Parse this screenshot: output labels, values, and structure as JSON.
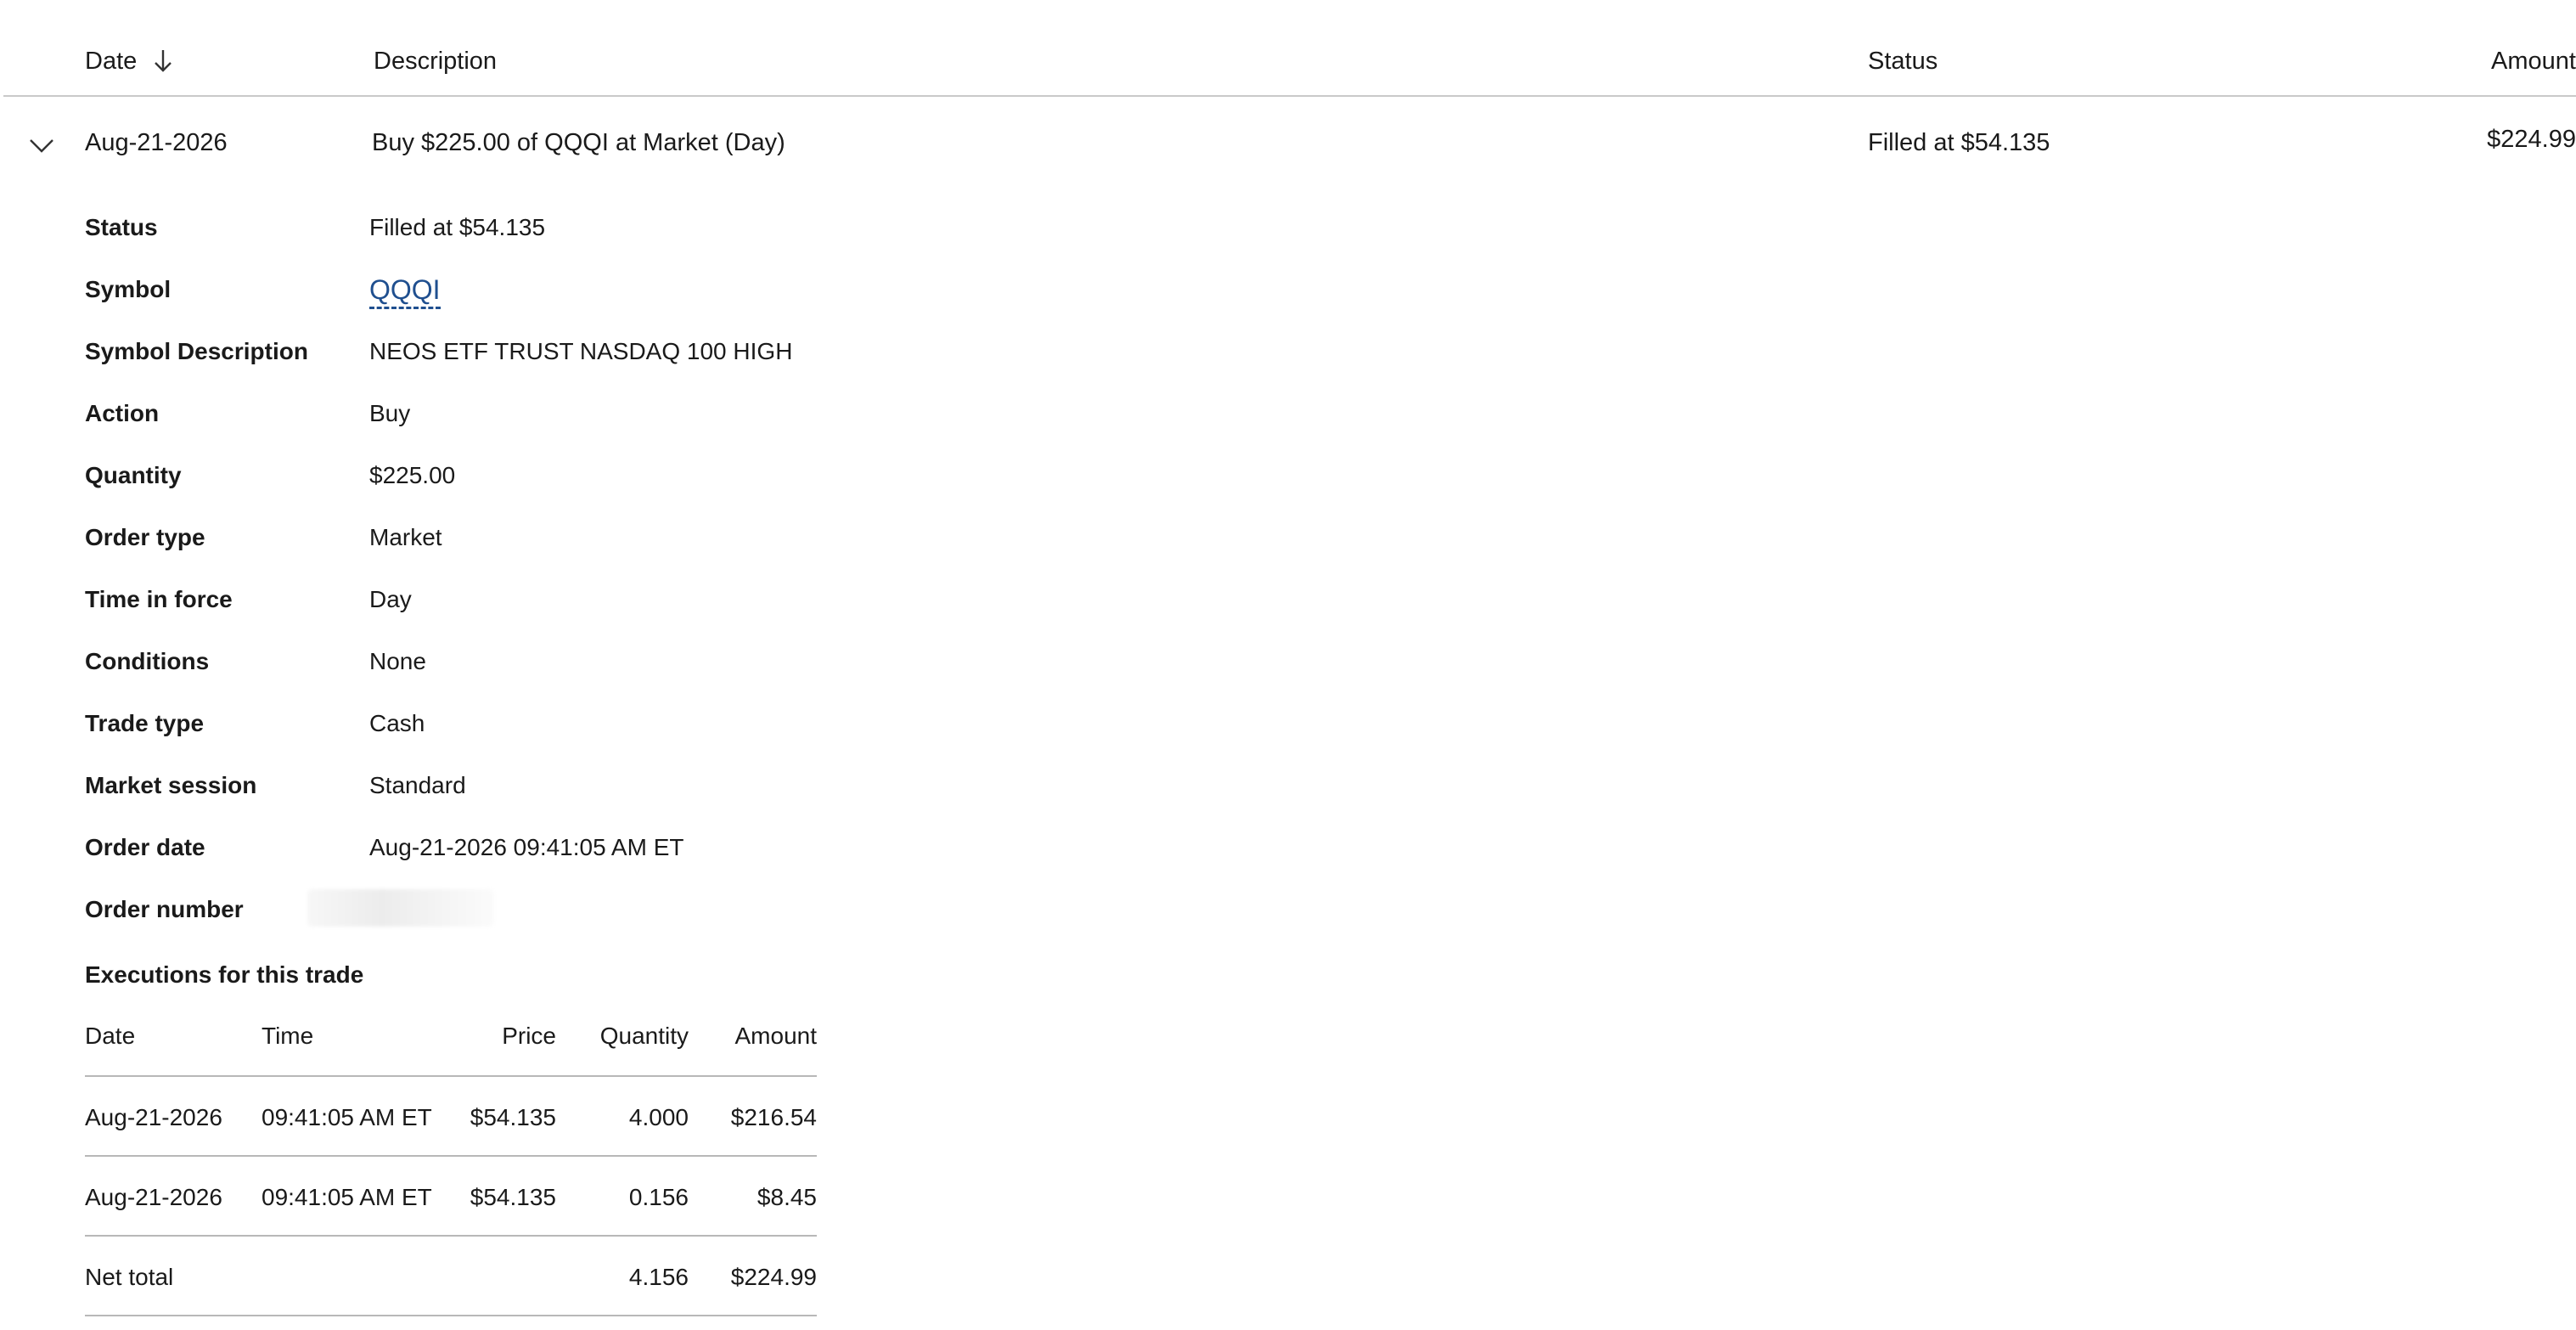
{
  "header": {
    "date_label": "Date",
    "sort_icon": "arrow-down-icon",
    "description_label": "Description",
    "status_label": "Status",
    "amount_label": "Amount"
  },
  "order": {
    "expand_icon": "chevron-down-icon",
    "date": "Aug-21-2026",
    "description": "Buy $225.00 of QQQI at Market (Day)",
    "status": "Filled at $54.135",
    "amount": "$224.99"
  },
  "details": {
    "status": {
      "label": "Status",
      "value": "Filled at $54.135"
    },
    "symbol": {
      "label": "Symbol",
      "value": "QQQI"
    },
    "symbol_description": {
      "label": "Symbol Description",
      "value": "NEOS ETF TRUST NASDAQ 100 HIGH"
    },
    "action": {
      "label": "Action",
      "value": "Buy"
    },
    "quantity": {
      "label": "Quantity",
      "value": "$225.00"
    },
    "order_type": {
      "label": "Order type",
      "value": "Market"
    },
    "time_in_force": {
      "label": "Time in force",
      "value": "Day"
    },
    "conditions": {
      "label": "Conditions",
      "value": "None"
    },
    "trade_type": {
      "label": "Trade type",
      "value": "Cash"
    },
    "market_session": {
      "label": "Market session",
      "value": "Standard"
    },
    "order_date": {
      "label": "Order date",
      "value": "Aug-21-2026 09:41:05 AM ET"
    },
    "order_number": {
      "label": "Order number"
    }
  },
  "executions": {
    "title": "Executions for this trade",
    "columns": {
      "date": "Date",
      "time": "Time",
      "price": "Price",
      "quantity": "Quantity",
      "amount": "Amount"
    },
    "rows": [
      {
        "date": "Aug-21-2026",
        "time": "09:41:05 AM ET",
        "price": "$54.135",
        "quantity": "4.000",
        "amount": "$216.54"
      },
      {
        "date": "Aug-21-2026",
        "time": "09:41:05 AM ET",
        "price": "$54.135",
        "quantity": "0.156",
        "amount": "$8.45"
      }
    ],
    "total": {
      "label": "Net total",
      "quantity": "4.156",
      "amount": "$224.99"
    }
  }
}
